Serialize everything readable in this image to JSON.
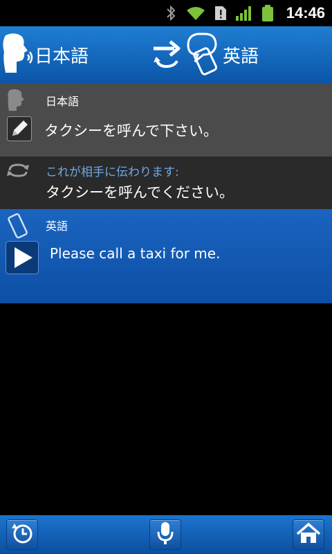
{
  "status_bar": {
    "time": "14:46",
    "icons": [
      "bluetooth-icon",
      "wifi-icon",
      "alert-icon",
      "signal-icon",
      "battery-icon"
    ]
  },
  "header": {
    "source_language": "日本語",
    "target_language": "英語",
    "swap_icon": "swap-arrows-icon"
  },
  "source_panel": {
    "language": "日本語",
    "text": "タクシーを呼んで下さい。",
    "edit_icon": "pencil-icon"
  },
  "back_translation": {
    "label": "これが相手に伝わります:",
    "text": "タクシーを呼んでください。"
  },
  "target_panel": {
    "language": "英語",
    "text": "Please call a taxi for me.",
    "play_icon": "play-icon"
  },
  "bottom_bar": {
    "history_icon": "history-icon",
    "mic_icon": "microphone-icon",
    "home_icon": "home-icon"
  },
  "colors": {
    "header_blue": "#1f7ed2",
    "panel_gray": "#4b4b4b",
    "back_panel": "#2a2a2a",
    "target_blue": "#1a64bf",
    "back_label": "#6ea8e6"
  }
}
